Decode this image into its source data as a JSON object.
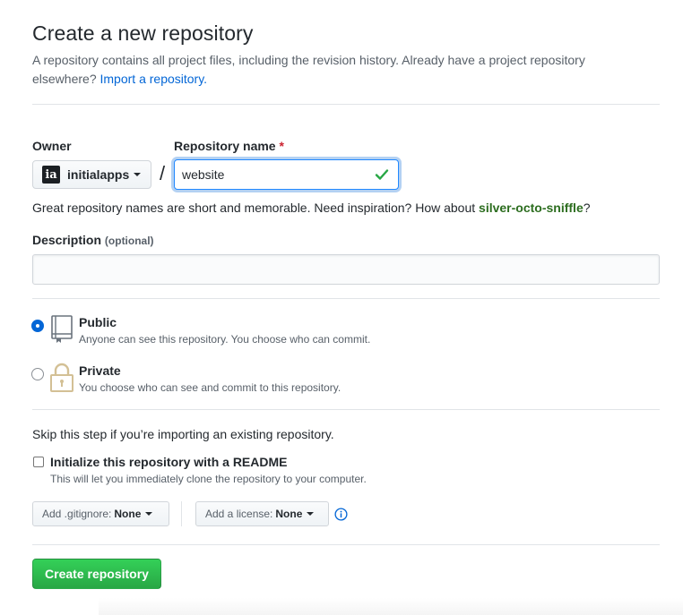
{
  "header": {
    "title": "Create a new repository",
    "subtitle_text": "A repository contains all project files, including the revision history. Already have a project repository elsewhere?",
    "import_link": "Import a repository."
  },
  "owner": {
    "label": "Owner",
    "avatar_text": "ia",
    "value": "initialapps"
  },
  "repo_name": {
    "label": "Repository name",
    "required_mark": "*",
    "value": "website",
    "separator": "/"
  },
  "hint": {
    "text": "Great repository names are short and memorable. Need inspiration? How about",
    "suggestion": "silver-octo-sniffle",
    "end": "?"
  },
  "description": {
    "label": "Description",
    "optional": "(optional)",
    "value": ""
  },
  "visibility": {
    "options": [
      {
        "title": "Public",
        "desc": "Anyone can see this repository. You choose who can commit.",
        "selected": true,
        "icon": "repo-book-icon"
      },
      {
        "title": "Private",
        "desc": "You choose who can see and commit to this repository.",
        "selected": false,
        "icon": "lock-icon"
      }
    ]
  },
  "init": {
    "skip_text": "Skip this step if you’re importing an existing repository.",
    "readme_title": "Initialize this repository with a README",
    "readme_desc": "This will let you immediately clone the repository to your computer.",
    "readme_checked": false,
    "gitignore_label": "Add .gitignore:",
    "gitignore_value": "None",
    "license_label": "Add a license:",
    "license_value": "None"
  },
  "actions": {
    "create_label": "Create repository"
  },
  "colors": {
    "accent_blue": "#0366d6",
    "create_green": "#28a745",
    "suggestion_green": "#2c6d1f",
    "required_red": "#cb2431"
  }
}
